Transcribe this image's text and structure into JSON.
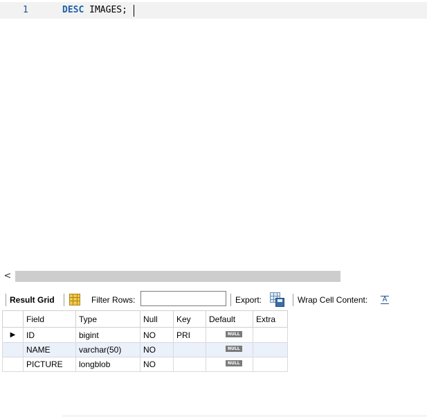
{
  "editor": {
    "line_number": "1",
    "keyword": "DESC",
    "identifier": " IMAGES",
    "terminator": ";"
  },
  "scrollbar": {
    "left_arrow": "<"
  },
  "toolbar": {
    "result_grid_label": "Result Grid",
    "filter_rows_label": "Filter Rows:",
    "filter_rows_value": "",
    "export_label": "Export:",
    "wrap_cell_label": "Wrap Cell Content:",
    "wrap_icon_glyph": "A"
  },
  "result": {
    "columns": [
      "Field",
      "Type",
      "Null",
      "Key",
      "Default",
      "Extra"
    ],
    "row_indicator": "▶",
    "rows": [
      {
        "field": "ID",
        "type": "bigint",
        "null": "NO",
        "key": "PRI",
        "default": "NULL",
        "extra": ""
      },
      {
        "field": "NAME",
        "type": "varchar(50)",
        "null": "NO",
        "key": "",
        "default": "NULL",
        "extra": ""
      },
      {
        "field": "PICTURE",
        "type": "longblob",
        "null": "NO",
        "key": "",
        "default": "NULL",
        "extra": ""
      }
    ]
  }
}
